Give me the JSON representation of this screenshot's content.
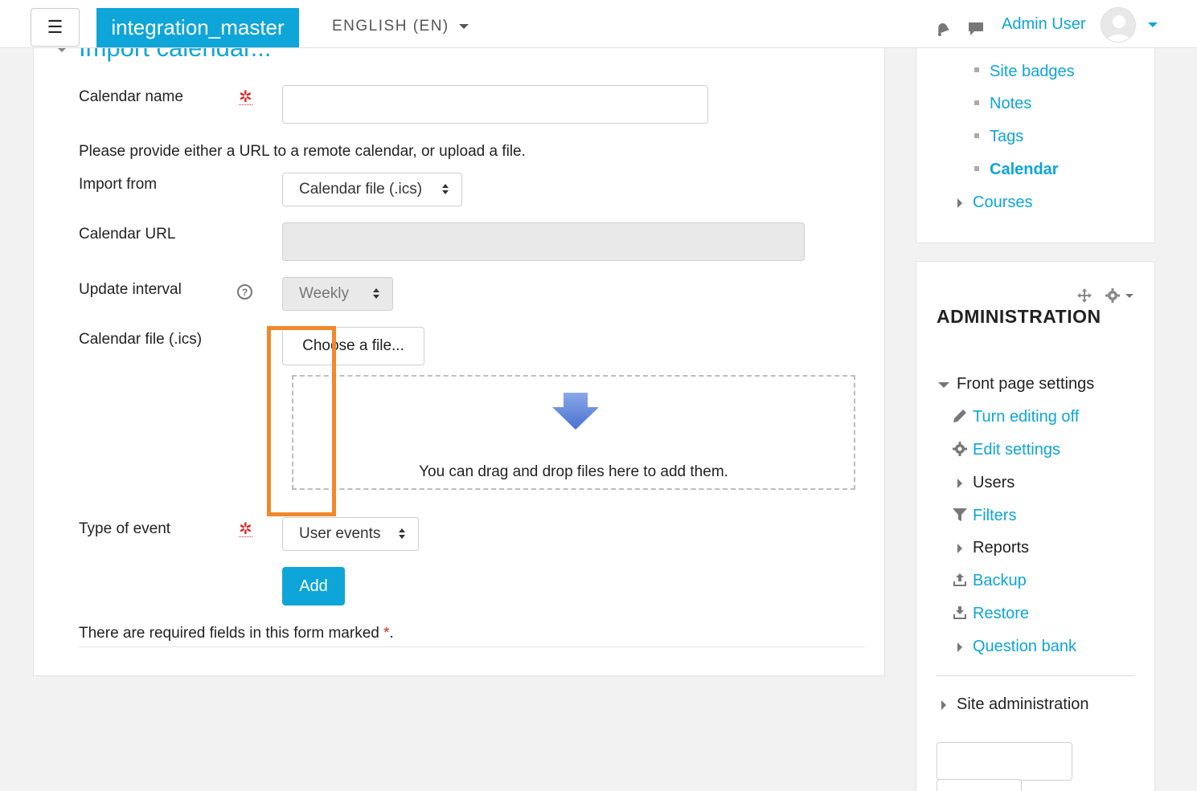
{
  "navbar": {
    "menu_glyph": "☰",
    "brand": "integration_master",
    "language": "ENGLISH (EN)",
    "user_name": "Admin User",
    "icons": [
      "bell-icon",
      "chat-icon",
      "avatar",
      "chevron-down-icon"
    ]
  },
  "form": {
    "section_title": "Import calendar...",
    "calendar_name_label": "Calendar name",
    "calendar_name_value": "",
    "instructions": "Please provide either a URL to a remote calendar, or upload a file.",
    "import_from_label": "Import from",
    "import_from_value": "Calendar file (.ics)",
    "calendar_url_label": "Calendar URL",
    "calendar_url_value": "",
    "update_interval_label": "Update interval",
    "update_interval_value": "Weekly",
    "calendar_file_label": "Calendar file (.ics)",
    "choose_file_label": "Choose a file...",
    "drop_text": "You can drag and drop files here to add them.",
    "type_of_event_label": "Type of event",
    "type_of_event_value": "User events",
    "add_label": "Add",
    "required_note": "There are required fields in this form marked",
    "required_star": "*",
    "required_period": "."
  },
  "navigation_block": {
    "items": [
      {
        "label": "Site badges"
      },
      {
        "label": "Notes"
      },
      {
        "label": "Tags"
      },
      {
        "label": "Calendar",
        "active": true
      },
      {
        "label": "Courses"
      }
    ]
  },
  "admin_block": {
    "title": "ADMINISTRATION",
    "front_page_settings": "Front page settings",
    "items": [
      {
        "label": "Turn editing off",
        "icon": "pencil-icon"
      },
      {
        "label": "Edit settings",
        "icon": "gear-icon"
      },
      {
        "label": "Users",
        "icon": "chevron-right-icon"
      },
      {
        "label": "Filters",
        "icon": "filter-icon"
      },
      {
        "label": "Reports",
        "icon": "chevron-right-icon"
      },
      {
        "label": "Backup",
        "icon": "upload-icon"
      },
      {
        "label": "Restore",
        "icon": "download-icon"
      },
      {
        "label": "Question bank",
        "icon": "chevron-right-icon"
      }
    ],
    "site_administration": "Site administration"
  },
  "colors": {
    "accent": "#0ea5d8",
    "highlight": "#f0892b",
    "required": "#e02020"
  }
}
